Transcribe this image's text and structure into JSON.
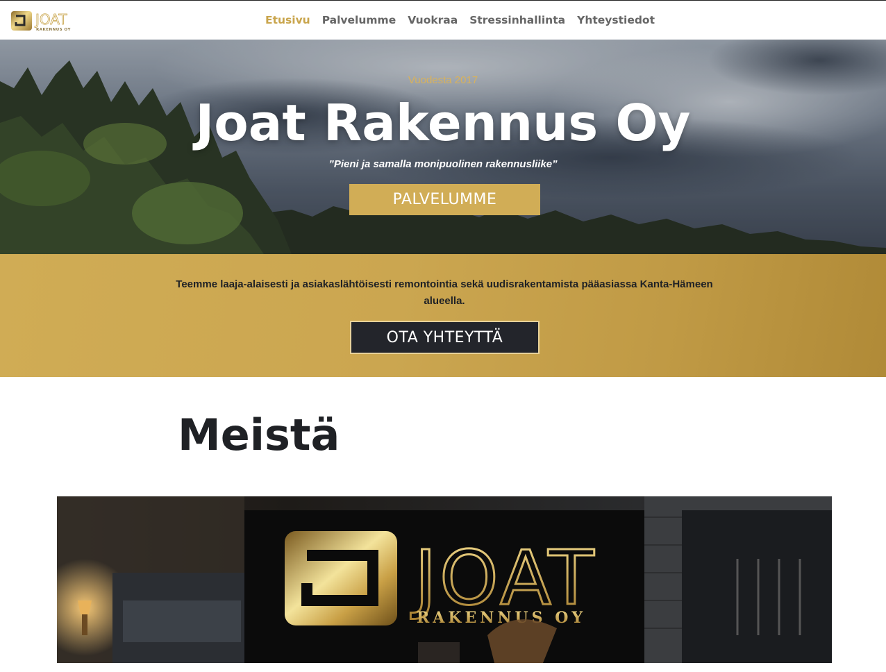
{
  "header": {
    "logo": {
      "icon": "joat-logo-icon",
      "wordmark": "JOAT",
      "subtitle": "RAKENNUS OY"
    },
    "nav": [
      {
        "label": "Etusivu",
        "active": true
      },
      {
        "label": "Palvelumme",
        "active": false
      },
      {
        "label": "Vuokraa",
        "active": false
      },
      {
        "label": "Stressinhallinta",
        "active": false
      },
      {
        "label": "Yhteystiedot",
        "active": false
      }
    ]
  },
  "hero": {
    "eyebrow": "Vuodesta 2017",
    "title": "Joat Rakennus Oy",
    "tagline": "”Pieni ja samalla monipuolinen rakennusliike”",
    "button_label": "PALVELUMME"
  },
  "band": {
    "text": "Teemme laaja-alaisesti ja asiakaslähtöisesti remontointia sekä uudisrakentamista pääasiassa Kanta-Hämeen alueella.",
    "button_label": "OTA YHTEYTTÄ"
  },
  "about": {
    "title": "Meistä",
    "image": {
      "logo_wordmark": "JOAT",
      "logo_subtitle": "RAKENNUS OY"
    }
  },
  "colors": {
    "accent_gold": "#d1ad56",
    "dark": "#23252b",
    "nav_text": "#666666"
  }
}
